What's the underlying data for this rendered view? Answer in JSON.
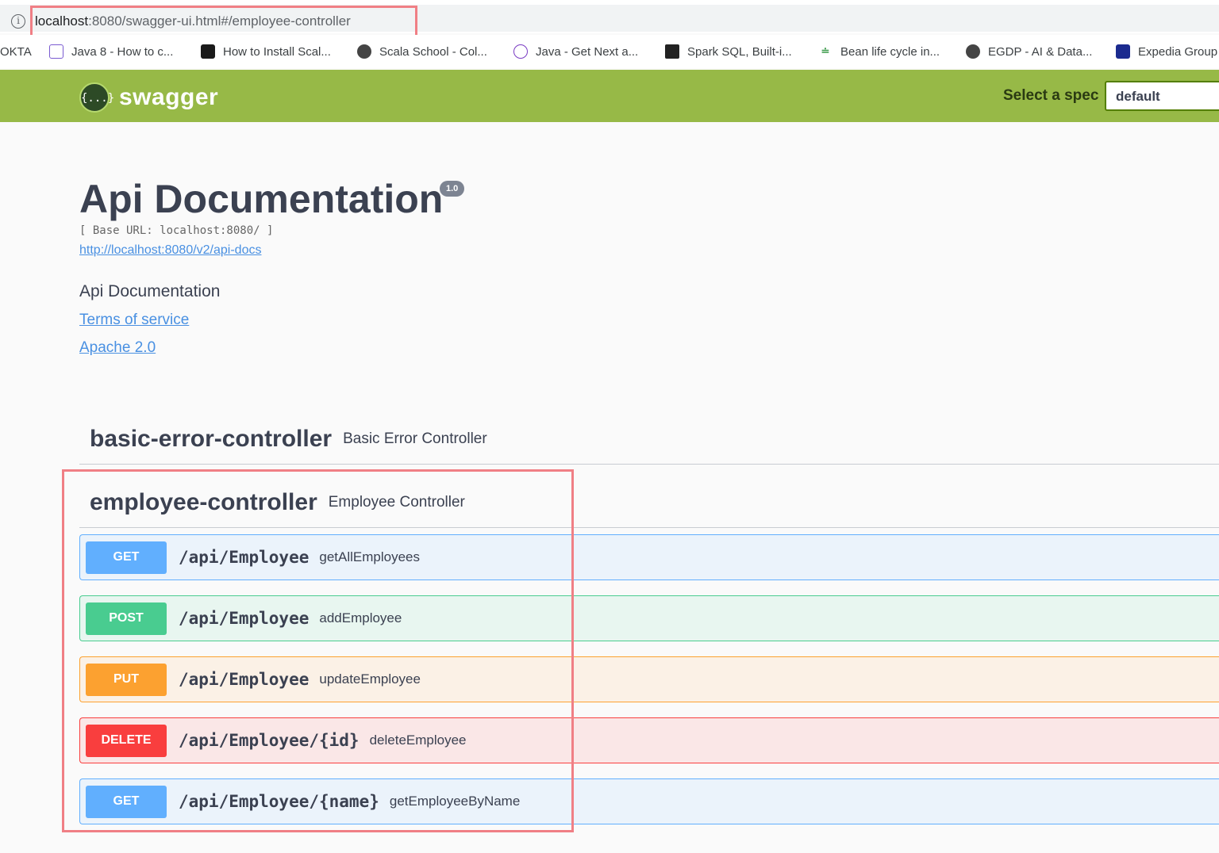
{
  "browser": {
    "url_host": "localhost",
    "url_rest": ":8080/swagger-ui.html#/employee-controller",
    "bookmarks": [
      {
        "label": "OKTA",
        "icon": "none"
      },
      {
        "label": "Java 8 - How to c...",
        "icon": "question-box-icon"
      },
      {
        "label": "How to Install Scal...",
        "icon": "dark-logo-icon"
      },
      {
        "label": "Scala School - Col...",
        "icon": "globe-icon"
      },
      {
        "label": "Java - Get Next a...",
        "icon": "pink-circle-icon"
      },
      {
        "label": "Spark SQL, Built-i...",
        "icon": "book-icon"
      },
      {
        "label": "Bean life cycle in...",
        "icon": "green-logo-icon"
      },
      {
        "label": "EGDP - AI & Data...",
        "icon": "globe-icon"
      },
      {
        "label": "Expedia Group",
        "icon": "blue-logo-icon"
      }
    ]
  },
  "topbar": {
    "logo_text": "swagger",
    "logo_glyph": "{...}",
    "spec_label": "Select a spec",
    "spec_value": "default"
  },
  "info": {
    "title": "Api Documentation",
    "version": "1.0",
    "base_url": "[ Base URL: localhost:8080/ ]",
    "api_docs_link": "http://localhost:8080/v2/api-docs",
    "description": "Api Documentation",
    "terms": "Terms of service",
    "license": "Apache 2.0"
  },
  "tags": [
    {
      "name": "basic-error-controller",
      "description": "Basic Error Controller"
    },
    {
      "name": "employee-controller",
      "description": "Employee Controller"
    }
  ],
  "operations": [
    {
      "method": "GET",
      "path": "/api/Employee",
      "summary": "getAllEmployees",
      "color": "#61affe"
    },
    {
      "method": "POST",
      "path": "/api/Employee",
      "summary": "addEmployee",
      "color": "#49cc90"
    },
    {
      "method": "PUT",
      "path": "/api/Employee",
      "summary": "updateEmployee",
      "color": "#fca130"
    },
    {
      "method": "DELETE",
      "path": "/api/Employee/{id}",
      "summary": "deleteEmployee",
      "color": "#f93e3e"
    },
    {
      "method": "GET",
      "path": "/api/Employee/{name}",
      "summary": "getEmployeeByName",
      "color": "#61affe"
    }
  ],
  "annotation_color": "#f07f85"
}
